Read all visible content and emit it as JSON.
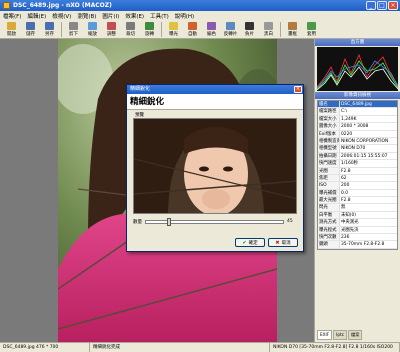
{
  "window": {
    "title": "DSC_6489.jpg - nXO (MACOZ)"
  },
  "menu": [
    "檔案(F)",
    "編輯(E)",
    "檢視(V)",
    "瀏覽(B)",
    "圖片(I)",
    "效果(E)",
    "工具(T)",
    "說明(H)"
  ],
  "toolbar": {
    "items": [
      {
        "label": "開啟",
        "icon": "folder-open-icon",
        "color": "#d9a93a"
      },
      {
        "label": "儲存",
        "icon": "save-icon",
        "color": "#4a6fb0"
      },
      {
        "label": "另存",
        "icon": "save-as-icon",
        "color": "#4a6fb0"
      },
      {
        "label": "剪下",
        "icon": "cut-icon",
        "color": "#888888"
      },
      {
        "label": "縮放",
        "icon": "zoom-icon",
        "color": "#5d9ad8"
      },
      {
        "label": "調整",
        "icon": "adjust-icon",
        "color": "#c05050"
      },
      {
        "label": "裁切",
        "icon": "crop-icon",
        "color": "#7a7a7a"
      },
      {
        "label": "旋轉",
        "icon": "rotate-icon",
        "color": "#3d8c3d"
      },
      {
        "label": "曝光",
        "icon": "exposure-icon",
        "color": "#e0c040"
      },
      {
        "label": "自動",
        "icon": "auto-icon",
        "color": "#d06030"
      },
      {
        "label": "編色",
        "icon": "color-icon",
        "color": "#8a5ab0"
      },
      {
        "label": "反轉片",
        "icon": "slide-icon",
        "color": "#5a8ac0"
      },
      {
        "label": "負片",
        "icon": "negative-icon",
        "color": "#333333"
      },
      {
        "label": "黑白",
        "icon": "grayscale-icon",
        "color": "#999999"
      },
      {
        "label": "畫框",
        "icon": "frame-icon",
        "color": "#b07a40"
      },
      {
        "label": "套用",
        "icon": "apply-icon",
        "color": "#4a9a4a"
      }
    ]
  },
  "panels": {
    "histogram_title": "直方圖",
    "info_title": "影像資訊檢視",
    "info": [
      {
        "k": "檔名",
        "v": "DSC_6489.jpg",
        "sel": true
      },
      {
        "k": "檔案路徑",
        "v": "C:\\"
      },
      {
        "k": "檔案大小",
        "v": "1,249K"
      },
      {
        "k": "圖像大小",
        "v": "2000 * 3008"
      },
      {
        "k": "Exif版本",
        "v": "0220"
      },
      {
        "k": "相機製造商",
        "v": "NIKON CORPORATION"
      },
      {
        "k": "相機型號",
        "v": "NIKON D70"
      },
      {
        "k": "拍攝日期",
        "v": "2006:01:15 15:55:07"
      },
      {
        "k": "快門速度",
        "v": "1/160秒"
      },
      {
        "k": "光圈",
        "v": "F2.8"
      },
      {
        "k": "焦距",
        "v": "62"
      },
      {
        "k": "ISO",
        "v": "200"
      },
      {
        "k": "曝光補償",
        "v": "0.0"
      },
      {
        "k": "最大光圈",
        "v": "F2.8"
      },
      {
        "k": "閃光",
        "v": "無"
      },
      {
        "k": "白平衡",
        "v": "未知(0)"
      },
      {
        "k": "測光方式",
        "v": "中央測光"
      },
      {
        "k": "曝光程式",
        "v": "光圈先決"
      },
      {
        "k": "快門次數",
        "v": "236"
      },
      {
        "k": "鏡頭",
        "v": "35-70mm F2.8-F2.8"
      }
    ],
    "tabs": [
      "EXIF",
      "Iptc",
      "檔案"
    ]
  },
  "status": {
    "file": "DSC_6489.jpg  476 * 700",
    "message": "精細銳化完成",
    "camera": "NIKON D70 [35-70mm F2.8-F2.8] F2.8 1/160s ISO200"
  },
  "dialog": {
    "title": "精細銳化",
    "heading": "精細銳化",
    "preview_label": "預覽",
    "slider_label": "數量",
    "slider_value": "45",
    "slider_fraction": 0.15,
    "ok_label": "確定",
    "cancel_label": "取消"
  },
  "colors": {
    "title_blue": "#1f5ec7",
    "chrome": "#ece9d8",
    "canvas_gray": "#7a7a7a",
    "sweater_pink": "#d8357a"
  }
}
